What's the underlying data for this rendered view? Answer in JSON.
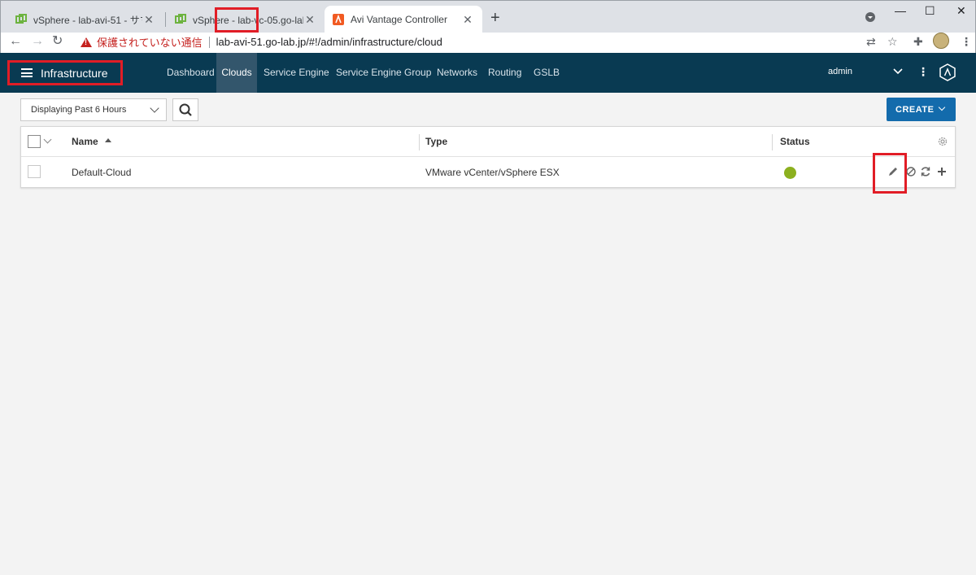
{
  "browser": {
    "tabs": [
      {
        "title": "vSphere - lab-avi-51 - サマリ",
        "active": false
      },
      {
        "title": "vSphere - lab-vc-05.go-lab.jp - サ",
        "active": false
      },
      {
        "title": "Avi Vantage Controller",
        "active": true
      }
    ],
    "new_tab_label": "+",
    "window_controls": {
      "minimize": "—",
      "maximize": "☐",
      "close": "✕"
    },
    "security_label": "保護されていない通信",
    "url": "lab-avi-51.go-lab.jp/#!/admin/infrastructure/cloud",
    "colors": {
      "insecure": "#c5221f",
      "tab_strip": "#dee1e6"
    }
  },
  "app": {
    "section_title": "Infrastructure",
    "nav": [
      {
        "label": "Dashboard"
      },
      {
        "label": "Clouds",
        "active": true
      },
      {
        "label": "Service Engine"
      },
      {
        "label": "Service Engine Group"
      },
      {
        "label": "Networks"
      },
      {
        "label": "Routing"
      },
      {
        "label": "GSLB"
      }
    ],
    "user": "admin",
    "colors": {
      "navbar": "#093a52",
      "active_nav": "#33566c",
      "highlight_box": "#e11d26"
    }
  },
  "toolbar": {
    "time_filter": "Displaying Past 6 Hours",
    "create_label": "CREATE",
    "create_color": "#136bac"
  },
  "table": {
    "columns": [
      "Name",
      "Type",
      "Status"
    ],
    "rows": [
      {
        "name": "Default-Cloud",
        "type": "VMware vCenter/vSphere ESX",
        "status_color": "#8cb01f"
      }
    ],
    "row_actions": [
      "edit-icon",
      "disable-icon",
      "refresh-icon",
      "add-icon"
    ]
  }
}
